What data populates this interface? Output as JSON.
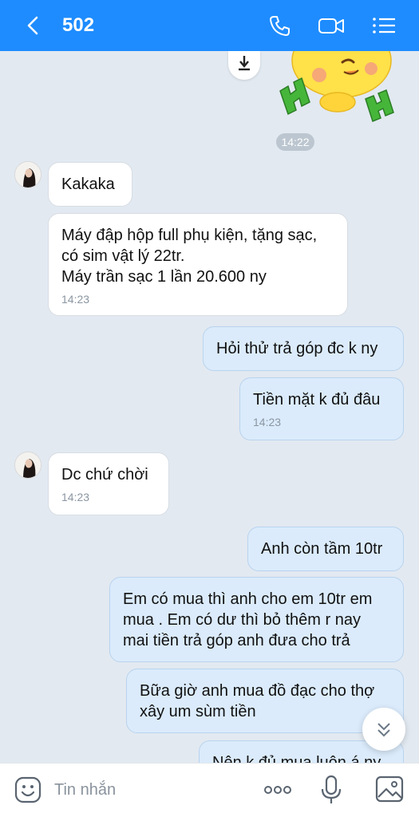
{
  "header": {
    "title": "502",
    "icons": [
      "back-icon",
      "phone-icon",
      "video-call-icon",
      "menu-list-icon"
    ]
  },
  "time_separator": "14:22",
  "messages": [
    {
      "side": "in",
      "lines": [
        "Kakaka"
      ],
      "time": ""
    },
    {
      "side": "in",
      "lines": [
        "Máy đập hộp full phụ kiện, tặng sạc,",
        "có sim vật lý 22tr.",
        "Máy trần sạc 1 lần 20.600 ny"
      ],
      "time": "14:23"
    },
    {
      "side": "out",
      "lines": [
        "Hỏi thử trả góp đc k ny"
      ],
      "time": ""
    },
    {
      "side": "out",
      "lines": [
        "Tiền mặt k đủ đâu"
      ],
      "time": "14:23"
    },
    {
      "side": "in",
      "lines": [
        "Dc chứ chời"
      ],
      "time": "14:23"
    },
    {
      "side": "out",
      "lines": [
        "Anh còn tầm 10tr"
      ],
      "time": ""
    },
    {
      "side": "out",
      "lines": [
        "Em có mua thì anh cho em 10tr em",
        "mua . Em có dư thì bỏ thêm r nay",
        "mai tiền trả góp anh đưa cho trả"
      ],
      "time": ""
    },
    {
      "side": "out",
      "lines": [
        "Bữa giờ anh mua đồ đạc cho thợ",
        "xây um sùm tiền"
      ],
      "time": ""
    },
    {
      "side": "out",
      "lines": [
        "Nên k đủ mua luôn á ny"
      ],
      "time": ""
    }
  ],
  "composer": {
    "placeholder": "Tin nhắn"
  },
  "colors": {
    "header": "#1e8cff",
    "chat_bg": "#e2e9f1",
    "incoming_bubble": "#ffffff",
    "outgoing_bubble": "#dbebfb"
  }
}
